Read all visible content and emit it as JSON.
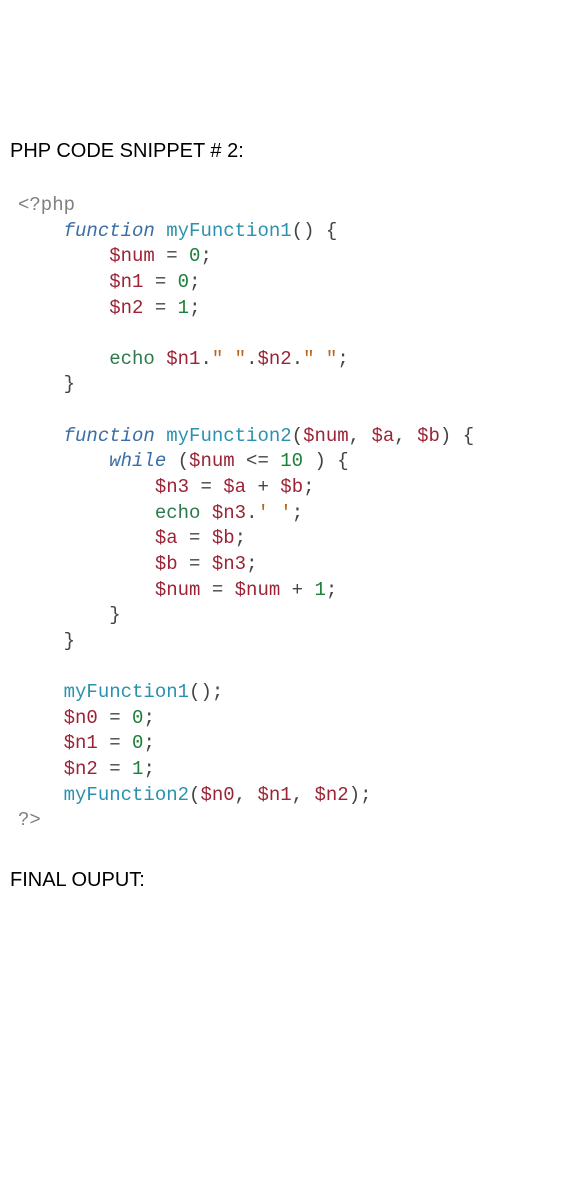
{
  "headings": {
    "title": "PHP CODE SNIPPET # 2:",
    "final": "FINAL OUPUT:"
  },
  "code": {
    "php_open": "<?php",
    "php_close": "?>",
    "kw_function": "function",
    "kw_while": "while",
    "kw_echo": "echo",
    "fn1": "myFunction1",
    "fn2": "myFunction2",
    "v_num": "$num",
    "v_n0": "$n0",
    "v_n1": "$n1",
    "v_n2": "$n2",
    "v_n3": "$n3",
    "v_a": "$a",
    "v_b": "$b",
    "n0": "0",
    "n1": "1",
    "n10": "10",
    "str_space_dq": "\" \"",
    "str_sp_sq": "' '",
    "p_open_paren": "(",
    "p_close_paren": ")",
    "p_open_brace": "{",
    "p_close_brace": "}",
    "p_eq": " = ",
    "p_semi": ";",
    "p_dot": ".",
    "p_le": " <= ",
    "p_plus": " + ",
    "p_comma": ", "
  }
}
